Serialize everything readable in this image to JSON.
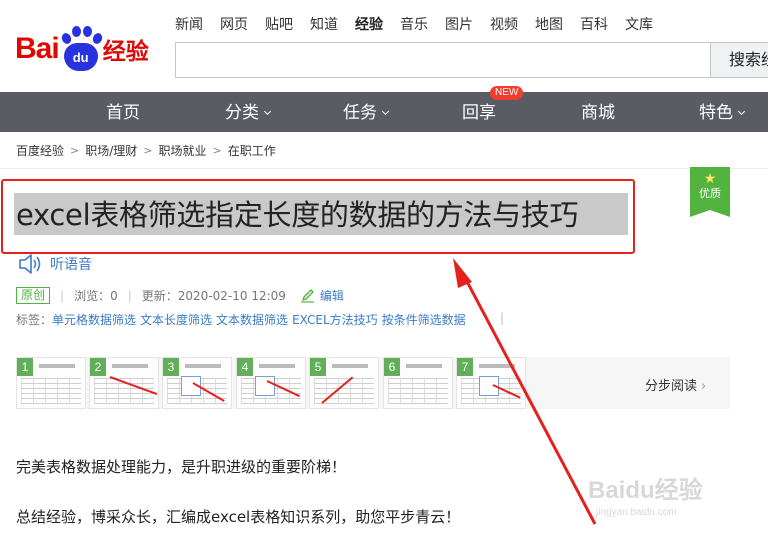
{
  "logo": {
    "bai": "Bai",
    "du": "du",
    "jingyan": "经验"
  },
  "topnav": [
    "新闻",
    "网页",
    "贴吧",
    "知道",
    "经验",
    "音乐",
    "图片",
    "视频",
    "地图",
    "百科",
    "文库"
  ],
  "topnav_active": "经验",
  "search": {
    "value": "",
    "button": "搜索经"
  },
  "mainnav": {
    "home": "首页",
    "category": "分类",
    "task": "任务",
    "share": "回享",
    "share_badge": "NEW",
    "mall": "商城",
    "special": "特色"
  },
  "breadcrumb": [
    "百度经验",
    "职场/理财",
    "职场就业",
    "在职工作"
  ],
  "quality_badge": {
    "star": "★",
    "label": "优质"
  },
  "article": {
    "title": "excel表格筛选指定长度的数据的方法与技巧",
    "listen": "听语音",
    "original": "原创",
    "views_label": "浏览：",
    "views": "0",
    "updated_label": "更新：",
    "updated": "2020-02-10 12:09",
    "edit": "编辑",
    "tags_label": "标签：",
    "tags": [
      "单元格数据筛选",
      "文本长度筛选",
      "文本数据筛选",
      "EXCEL方法技巧",
      "按条件筛选数据"
    ],
    "tags_sep": "|",
    "step_read": "分步阅读",
    "step_read_arrow": "›",
    "paragraph1": "完美表格数据处理能力，是升职进级的重要阶梯！",
    "paragraph2": "总结经验，博采众长，汇编成excel表格知识系列，助您平步青云！"
  },
  "thumbnails": [
    "1",
    "2",
    "3",
    "4",
    "5",
    "6",
    "7"
  ],
  "watermark": {
    "brand": "Baidu经验",
    "url": "jingyan.baidu.com"
  },
  "colors": {
    "brand_red": "#e10602",
    "brand_blue": "#2932e1",
    "nav_bg": "#595c63",
    "link": "#3a7cc9",
    "green": "#52b33f",
    "annotation_red": "#e5211d"
  }
}
